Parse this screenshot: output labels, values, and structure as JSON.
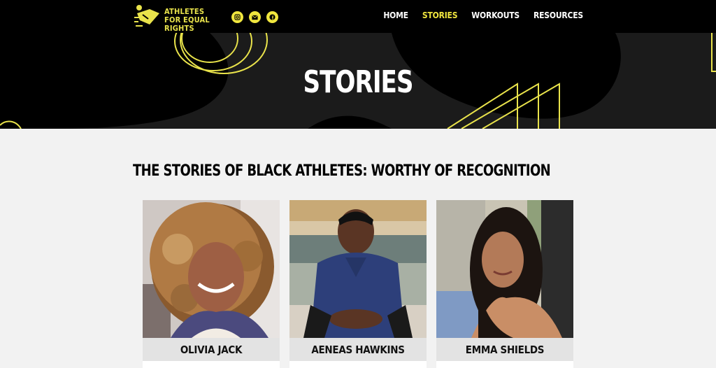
{
  "brand": {
    "name": "ATHLETES FOR EQUAL RIGHTS",
    "accent": "#f0e63e",
    "socials": [
      {
        "icon": "instagram-icon"
      },
      {
        "icon": "email-icon"
      },
      {
        "icon": "facebook-icon"
      }
    ]
  },
  "nav": {
    "items": [
      {
        "label": "HOME",
        "active": false
      },
      {
        "label": "STORIES",
        "active": true
      },
      {
        "label": "WORKOUTS",
        "active": false
      },
      {
        "label": "RESOURCES",
        "active": false
      }
    ]
  },
  "hero": {
    "title": "STORIES"
  },
  "main": {
    "heading": "THE STORIES OF BLACK ATHLETES: WORTHY OF RECOGNITION",
    "cards": [
      {
        "name": "OLIVIA JACK"
      },
      {
        "name": "AENEAS HAWKINS"
      },
      {
        "name": "EMMA SHIELDS"
      }
    ]
  }
}
